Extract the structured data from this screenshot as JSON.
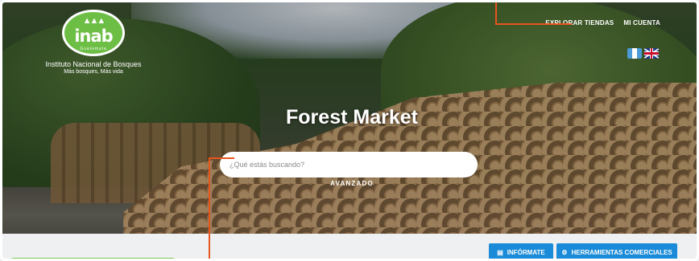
{
  "logo": {
    "wordmark": "inab",
    "country": "Guatemala",
    "name": "Instituto Nacional de Bosques",
    "tagline": "Más bosques, Más vida"
  },
  "nav": {
    "items": [
      {
        "label": "EXPLORAR TIENDAS"
      },
      {
        "label": "MI CUENTA"
      }
    ]
  },
  "languages": [
    "guatemala-flag-icon",
    "uk-flag-icon"
  ],
  "hero": {
    "title": "Forest Market",
    "search_placeholder": "¿Qué estás buscando?",
    "advanced_label": "AVANZADO"
  },
  "actions": {
    "info_label": "INFÓRMATE",
    "info_icon": "newspaper-icon",
    "tools_label": "HERRAMIENTAS COMERCIALES",
    "tools_icon": "gear-icon"
  },
  "colors": {
    "accent_blue": "#1a8bd8",
    "brand_green": "#6cbe45",
    "annotation_orange": "#e8541e"
  }
}
